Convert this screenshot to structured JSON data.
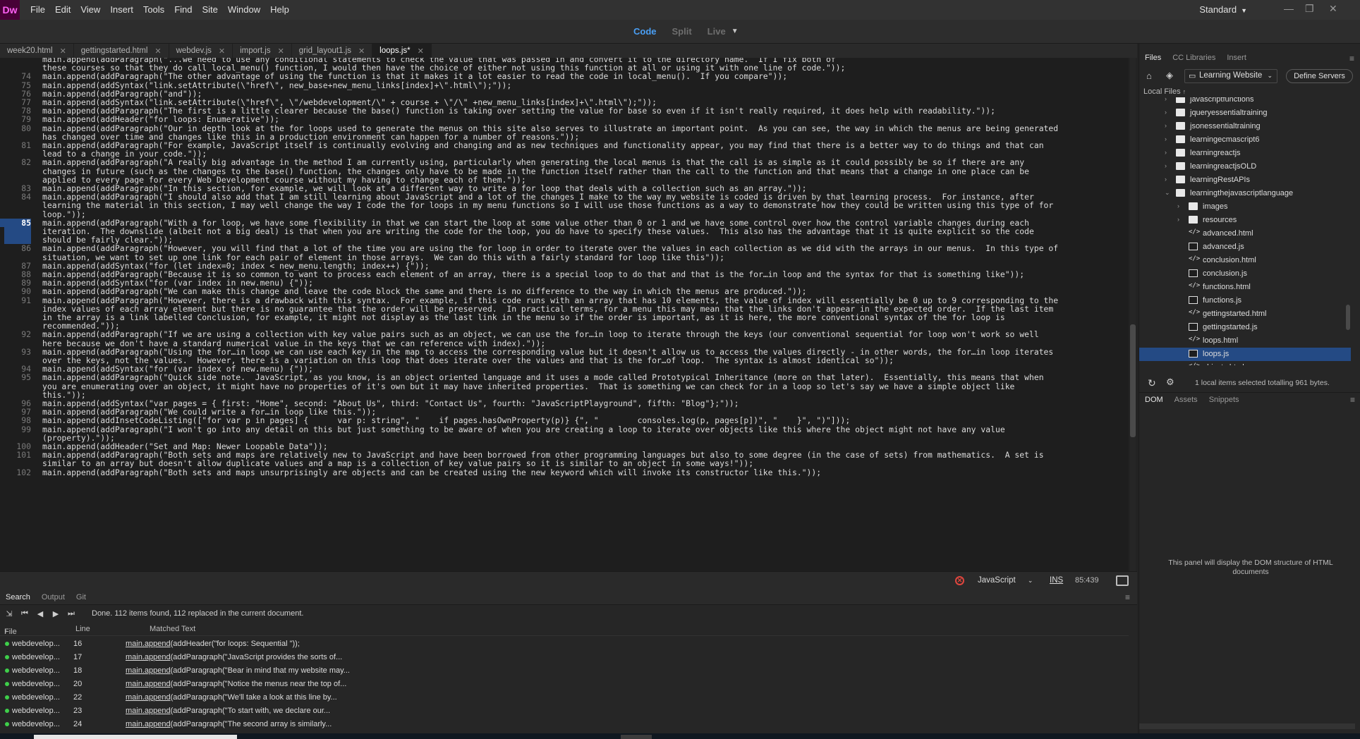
{
  "app": {
    "logo": "Dw",
    "workspace": "Standard",
    "accent": "#4a9ff5",
    "logo_bg": "#470137",
    "logo_fg": "#ff61f6"
  },
  "menu": [
    "File",
    "Edit",
    "View",
    "Insert",
    "Tools",
    "Find",
    "Site",
    "Window",
    "Help"
  ],
  "view_modes": {
    "code": "Code",
    "split": "Split",
    "live": "Live"
  },
  "tabs": [
    {
      "label": "week20.html",
      "active": false
    },
    {
      "label": "gettingstarted.html",
      "active": false
    },
    {
      "label": "webdev.js",
      "active": false
    },
    {
      "label": "import.js",
      "active": false
    },
    {
      "label": "grid_layout1.js",
      "active": false
    },
    {
      "label": "loops.js*",
      "active": true
    }
  ],
  "editor": {
    "current_line": 85,
    "lines": [
      {
        "n": "",
        "t": "main.append(addParagraph(\"...we need to use any conditional statements to check the value that was passed in and convert it to the directory name.  If I fix both of"
      },
      {
        "n": "",
        "t": "these courses so that they do call local_menu() function, I would then have the choice of either not using this function at all or using it with one line of code.\"));"
      },
      {
        "n": "74",
        "t": "main.append(addParagraph(\"The other advantage of using the function is that it makes it a lot easier to read the code in local_menu().  If you compare\"));"
      },
      {
        "n": "75",
        "t": "main.append(addSyntax(\"link.setAttribute(\\\"href\\\", new_base+new_menu_links[index]+\\\".html\\\");\"));"
      },
      {
        "n": "76",
        "t": "main.append(addParagraph(\"and\"));"
      },
      {
        "n": "77",
        "t": "main.append(addSyntax(\"link.setAttribute(\\\"href\\\", \\\"/webdevelopment/\\\" + course + \\\"/\\\" +new_menu_links[index]+\\\".html\\\");\"));"
      },
      {
        "n": "78",
        "t": "main.append(addParagraph(\"The first is a little clearer because the base() function is taking over setting the value for base so even if it isn't really required, it does help with readability.\"));"
      },
      {
        "n": "79",
        "t": "main.append(addHeader(\"for loops: Enumerative\"));"
      },
      {
        "n": "80",
        "t": "main.append(addParagraph(\"Our in depth look at the for loops used to generate the menus on this site also serves to illustrate an important point.  As you can see, the way in which the menus are being generated"
      },
      {
        "n": "",
        "t": "has changed over time and changes like this in a production environment can happen for a number of reasons.\"));"
      },
      {
        "n": "81",
        "t": "main.append(addParagraph(\"For example, JavaScript itself is continually evolving and changing and as new techniques and functionality appear, you may find that there is a better way to do things and that can"
      },
      {
        "n": "",
        "t": "lead to a change in your code.\"));"
      },
      {
        "n": "82",
        "t": "main.append(addParagraph(\"A really big advantage in the method I am currently using, particularly when generating the local menus is that the call is as simple as it could possibly be so if there are any"
      },
      {
        "n": "",
        "t": "changes in future (such as the changes to the base() function, the changes only have to be made in the function itself rather than the call to the function and that means that a change in one place can be"
      },
      {
        "n": "",
        "t": "applied to every page for every Web Development course without my having to change each of them.\"));"
      },
      {
        "n": "83",
        "t": "main.append(addParagraph(\"In this section, for example, we will look at a different way to write a for loop that deals with a collection such as an array.\"));"
      },
      {
        "n": "84",
        "t": "main.append(addParagraph(\"I should also add that I am still learning about JavaScript and a lot of the changes I make to the way my website is coded is driven by that learning process.  For instance, after"
      },
      {
        "n": "",
        "t": "learning the material in this section, I may well change the way I code the for loops in my menu functions so I will use those functions as a way to demonstrate how they could be written using this type of for"
      },
      {
        "n": "",
        "t": "loop.\"));"
      },
      {
        "n": "85",
        "t": "main.append(addParagraph(\"With a for loop, we have some flexibility in that we can start the loop at some value other than 0 or 1 and we have some control over how the control variable changes during each"
      },
      {
        "n": "",
        "t": "iteration.  The downslide (albeit not a big deal) is that when you are writing the code for the loop, you do have to specify these values.  This also has the advantage that it is quite explicit so the code"
      },
      {
        "n": "",
        "t": "should be fairly clear.\"));"
      },
      {
        "n": "86",
        "t": "main.append(addParagraph(\"However, you will find that a lot of the time you are using the for loop in order to iterate over the values in each collection as we did with the arrays in our menus.  In this type of"
      },
      {
        "n": "",
        "t": "situation, we want to set up one link for each pair of element in those arrays.  We can do this with a fairly standard for loop like this\"));"
      },
      {
        "n": "87",
        "t": "main.append(addSyntax(\"for (let index=0; index < new_menu.length; index++) {\"));"
      },
      {
        "n": "88",
        "t": "main.append(addParagraph(\"Because it is so common to want to process each element of an array, there is a special loop to do that and that is the for…in loop and the syntax for that is something like\"));"
      },
      {
        "n": "89",
        "t": "main.append(addSyntax(\"for (var index in new.menu) {\"));"
      },
      {
        "n": "90",
        "t": "main.append(addParagraph(\"We can make this change and leave the code block the same and there is no difference to the way in which the menus are produced.\"));"
      },
      {
        "n": "91",
        "t": "main.append(addParagraph(\"However, there is a drawback with this syntax.  For example, if this code runs with an array that has 10 elements, the value of index will essentially be 0 up to 9 corresponding to the"
      },
      {
        "n": "",
        "t": "index values of each array element but there is no guarantee that the order will be preserved.  In practical terms, for a menu this may mean that the links don't appear in the expected order.  If the last item"
      },
      {
        "n": "",
        "t": "in the array is a link labelled Conclusion, for example, it might not display as the last link in the menu so if the order is important, as it is here, the more conventional syntax of the for loop is"
      },
      {
        "n": "",
        "t": "recommended.\"));"
      },
      {
        "n": "92",
        "t": "main.append(addParagraph(\"If we are using a collection with key value pairs such as an object, we can use the for…in loop to iterate through the keys (our conventional sequential for loop won't work so well"
      },
      {
        "n": "",
        "t": "here because we don't have a standard numerical value in the keys that we can reference with index).\"));"
      },
      {
        "n": "93",
        "t": "main.append(addParagraph(\"Using the for…in loop we can use each key in the map to access the corresponding value but it doesn't allow us to access the values directly - in other words, the for…in loop iterates"
      },
      {
        "n": "",
        "t": "over the keys, not the values.  However, there is a variation on this loop that does iterate over the values and that is the for…of loop.  The syntax is almost identical so\"));"
      },
      {
        "n": "94",
        "t": "main.append(addSyntax(\"for (var index of new.menu) {\"));"
      },
      {
        "n": "95",
        "t": "main.append(addParagraph(\"Quick side note.  JavaScript, as you know, is an object oriented language and it uses a mode called Prototypical Inheritance (more on that later).  Essentially, this means that when"
      },
      {
        "n": "",
        "t": "you are enumerating over an object, it might have no properties of it's own but it may have inherited properties.  That is something we can check for in a loop so let's say we have a simple object like"
      },
      {
        "n": "",
        "t": "this.\"));"
      },
      {
        "n": "96",
        "t": "main.append(addSyntax(\"var pages = { first: \"Home\", second: \"About Us\", third: \"Contact Us\", fourth: \"JavaScriptPlayground\", fifth: \"Blog\"};\"));"
      },
      {
        "n": "97",
        "t": "main.append(addParagraph(\"We could write a for…in loop like this.\"));"
      },
      {
        "n": "98",
        "t": "main.append(addInsetCodeListing([\"for var p in pages] {      var p: string\", \"    if pages.hasOwnProperty(p)} {\", \"        consoles.log(p, pages[p])\", \"    }\", \")\"]));"
      },
      {
        "n": "99",
        "t": "main.append(addParagraph(\"I won't go into any detail on this but just something to be aware of when you are creating a loop to iterate over objects like this where the object might not have any value"
      },
      {
        "n": "",
        "t": "(property).\"));"
      },
      {
        "n": "100",
        "t": "main.append(addHeader(\"Set and Map: Newer Loopable Data\"));"
      },
      {
        "n": "101",
        "t": "main.append(addParagraph(\"Both sets and maps are relatively new to JavaScript and have been borrowed from other programming languages but also to some degree (in the case of sets) from mathematics.  A set is"
      },
      {
        "n": "",
        "t": "similar to an array but doesn't allow duplicate values and a map is a collection of key value pairs so it is similar to an object in some ways!\"));"
      },
      {
        "n": "102",
        "t": "main.append(addParagraph(\"Both sets and maps unsurprisingly are objects and can be created using the new keyword which will invoke its constructor like this.\"));"
      }
    ]
  },
  "statusbar": {
    "language": "JavaScript",
    "mode": "INS",
    "position": "85:439"
  },
  "search": {
    "tabs": [
      "Search",
      "Output",
      "Git"
    ],
    "status": "Done. 112 items found, 112 replaced in the current document.",
    "columns": {
      "file": "File",
      "line": "Line",
      "matched": "Matched Text"
    },
    "results": [
      {
        "file": "webdevelop...",
        "line": "16",
        "match_prefix": "main.append",
        "match_rest": "(addHeader(\"for loops: Sequential \"));"
      },
      {
        "file": "webdevelop...",
        "line": "17",
        "match_prefix": "main.append",
        "match_rest": "(addParagraph(\"JavaScript provides the sorts of..."
      },
      {
        "file": "webdevelop...",
        "line": "18",
        "match_prefix": "main.append",
        "match_rest": "(addParagraph(\"Bear in mind that my website may..."
      },
      {
        "file": "webdevelop...",
        "line": "20",
        "match_prefix": "main.append",
        "match_rest": "(addParagraph(\"Notice the menus near the top of..."
      },
      {
        "file": "webdevelop...",
        "line": "22",
        "match_prefix": "main.append",
        "match_rest": "(addParagraph(\"We'll take a look at this line by..."
      },
      {
        "file": "webdevelop...",
        "line": "23",
        "match_prefix": "main.append",
        "match_rest": "(addParagraph(\"To start with, we declare our..."
      },
      {
        "file": "webdevelop...",
        "line": "24",
        "match_prefix": "main.append",
        "match_rest": "(addParagraph(\"The second array is similarly..."
      }
    ]
  },
  "files_panel": {
    "tabs": [
      "Files",
      "CC Libraries",
      "Insert"
    ],
    "site": "Learning Website",
    "define_servers": "Define Servers",
    "local_files": "Local Files",
    "tree": [
      {
        "label": "javascriptfunctions",
        "type": "folder",
        "depth": 2,
        "expanded": false
      },
      {
        "label": "jqueryessentialtraining",
        "type": "folder",
        "depth": 2,
        "expanded": false
      },
      {
        "label": "jsonessentialtraining",
        "type": "folder",
        "depth": 2,
        "expanded": false
      },
      {
        "label": "learningecmascript6",
        "type": "folder",
        "depth": 2,
        "expanded": false
      },
      {
        "label": "learningreactjs",
        "type": "folder",
        "depth": 2,
        "expanded": false
      },
      {
        "label": "learningreactjsOLD",
        "type": "folder",
        "depth": 2,
        "expanded": false
      },
      {
        "label": "learningRestAPIs",
        "type": "folder",
        "depth": 2,
        "expanded": false
      },
      {
        "label": "learningthejavascriptlanguage",
        "type": "folder",
        "depth": 2,
        "expanded": true
      },
      {
        "label": "images",
        "type": "folder",
        "depth": 3,
        "expanded": false
      },
      {
        "label": "resources",
        "type": "folder",
        "depth": 3,
        "expanded": false
      },
      {
        "label": "advanced.html",
        "type": "html",
        "depth": 3
      },
      {
        "label": "advanced.js",
        "type": "js",
        "depth": 3
      },
      {
        "label": "conclusion.html",
        "type": "html",
        "depth": 3
      },
      {
        "label": "conclusion.js",
        "type": "js",
        "depth": 3
      },
      {
        "label": "functions.html",
        "type": "html",
        "depth": 3
      },
      {
        "label": "functions.js",
        "type": "js",
        "depth": 3
      },
      {
        "label": "gettingstarted.html",
        "type": "html",
        "depth": 3
      },
      {
        "label": "gettingstarted.js",
        "type": "js",
        "depth": 3
      },
      {
        "label": "loops.html",
        "type": "html",
        "depth": 3
      },
      {
        "label": "loops.js",
        "type": "js",
        "depth": 3,
        "selected": true
      },
      {
        "label": "objects.html",
        "type": "html",
        "depth": 3
      }
    ],
    "footer": "1 local items selected totalling 961 bytes."
  },
  "dom_panel": {
    "tabs": [
      "DOM",
      "Assets",
      "Snippets"
    ],
    "message": "This panel will display the DOM structure of HTML documents"
  }
}
